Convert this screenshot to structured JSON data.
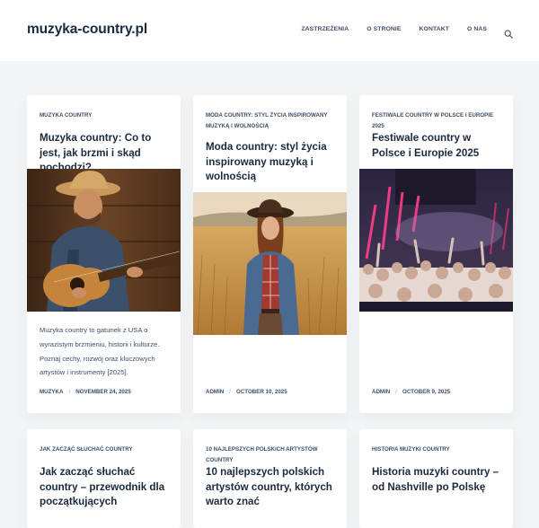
{
  "site": {
    "logo": "muzyka-country.pl"
  },
  "nav": {
    "items": [
      {
        "label": "ZASTRZEŻENIA"
      },
      {
        "label": "O STRONIE"
      },
      {
        "label": "KONTAKT"
      },
      {
        "label": "O NAS"
      }
    ],
    "search_icon": "search-icon"
  },
  "posts": [
    {
      "category": "MUZYKA COUNTRY",
      "title": "Muzyka country: Co to jest, jak brzmi i skąd pochodzi?",
      "image": "guitarist-cowboy-hat",
      "excerpt": "Muzyka country to gatunek z USA o wyrazistym brzmieniu, historii i kulturze. Poznaj cechy, rozwój oraz kluczowych artystów i instrumenty [2025].",
      "author": "MUZYKA",
      "date": "NOVEMBER 24, 2025"
    },
    {
      "category": "MODA COUNTRY: STYL ŻYCIA INSPIROWANY MUZYKĄ I WOLNOŚCIĄ",
      "title": "Moda country: styl życia inspirowany muzyką i wolnością",
      "image": "woman-in-wheat-field",
      "author": "ADMIN",
      "date": "OCTOBER 10, 2025"
    },
    {
      "category": "FESTIWALE COUNTRY W POLSCE I EUROPIE 2025",
      "title": "Festiwale country w Polsce i Europie 2025",
      "image": "festival-crowd-stage",
      "author": "ADMIN",
      "date": "OCTOBER 9, 2025"
    },
    {
      "category": "JAK ZACZĄĆ SŁUCHAĆ COUNTRY",
      "title": "Jak zacząć słuchać country – przewodnik dla początkujących"
    },
    {
      "category": "10 NAJLEPSZYCH POLSKICH ARTYSTÓW COUNTRY",
      "title": "10 najlepszych polskich artystów country, których warto znać"
    },
    {
      "category": "HISTORIA MUZYKI COUNTRY",
      "title": "Historia muzyki country – od Nashville po Polskę"
    }
  ]
}
